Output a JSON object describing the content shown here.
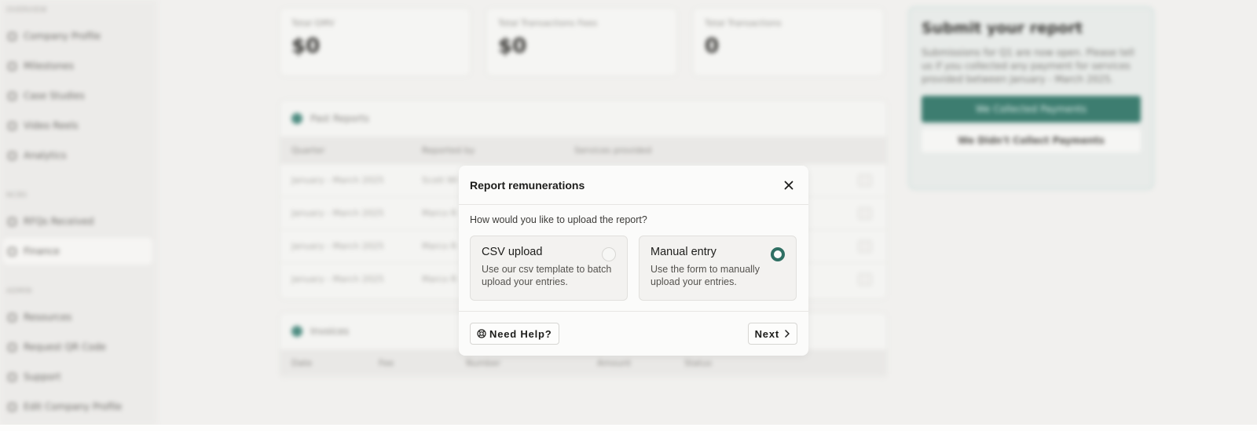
{
  "sidebar": {
    "sections": [
      "Overview",
      "NCBS",
      "Admin"
    ],
    "items": [
      {
        "label": "Company Profile"
      },
      {
        "label": "Milestones"
      },
      {
        "label": "Case Studies"
      },
      {
        "label": "Video Reels"
      },
      {
        "label": "Analytics"
      },
      {
        "label": "RFQs Received"
      },
      {
        "label": "Finance"
      },
      {
        "label": "Resources"
      },
      {
        "label": "Request QR Code"
      },
      {
        "label": "Support"
      },
      {
        "label": "Edit Company Profile"
      }
    ]
  },
  "stats": [
    {
      "label": "Total GMV",
      "value": "$0"
    },
    {
      "label": "Total Transactions Fees",
      "value": "$0"
    },
    {
      "label": "Total Transactions",
      "value": "0"
    }
  ],
  "past_reports": {
    "title": "Past Reports",
    "columns": [
      "Quarter",
      "Reported by",
      "Services provided"
    ],
    "rows": [
      {
        "quarter": "January - March 2025",
        "by": "Scott Wi"
      },
      {
        "quarter": "January - March 2025",
        "by": "Marco R"
      },
      {
        "quarter": "January - March 2025",
        "by": "Marco R"
      },
      {
        "quarter": "January - March 2025",
        "by": "Marco R"
      }
    ]
  },
  "invoices": {
    "title": "Invoices",
    "columns": [
      "Date",
      "Fee",
      "Number",
      "Amount",
      "Status"
    ]
  },
  "submit_card": {
    "title": "Submit your report",
    "body": "Submissions for Q1 are now open. Please tell us if you collected any payment for services provided between January - March 2025.",
    "primary": "We Collected Payments",
    "secondary": "We Didn't Collect Payments"
  },
  "modal": {
    "title": "Report remunerations",
    "question": "How would you like to upload the report?",
    "options": [
      {
        "title": "CSV upload",
        "desc": "Use our csv template to batch upload your entries.",
        "selected": false
      },
      {
        "title": "Manual entry",
        "desc": "Use the form to manually upload your entries.",
        "selected": true
      }
    ],
    "help_label": "Need Help?",
    "next_label": "Next"
  },
  "colors": {
    "accent": "#2f6f63",
    "page_bg": "#f1f0ee",
    "modal_bg": "#fbfbfa"
  },
  "icons": {
    "close": "close-icon",
    "help": "help-lifebuoy-icon",
    "next": "chevron-right-icon"
  }
}
